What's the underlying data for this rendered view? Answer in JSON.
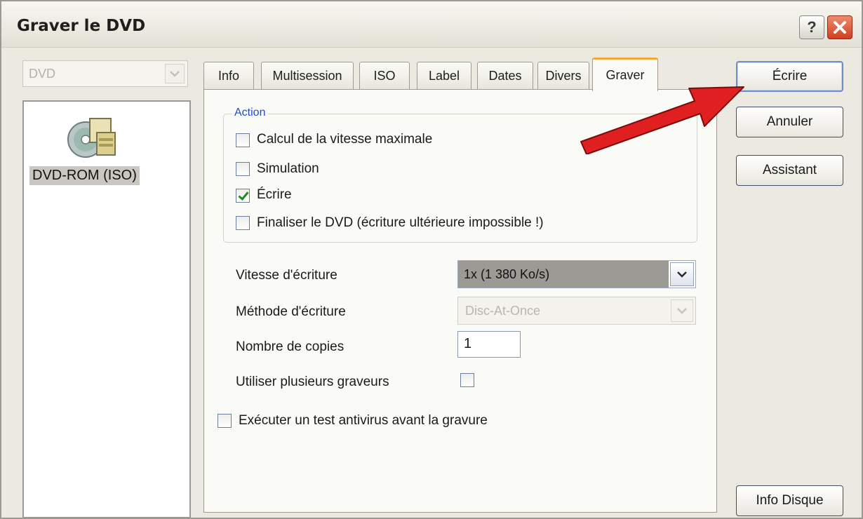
{
  "window": {
    "title": "Graver le DVD",
    "help_glyph": "?",
    "close_glyph": "✕"
  },
  "left": {
    "drive_combo": "DVD",
    "list_item": "DVD-ROM (ISO)"
  },
  "tabs": [
    {
      "label": "Info"
    },
    {
      "label": "Multisession"
    },
    {
      "label": "ISO"
    },
    {
      "label": "Label"
    },
    {
      "label": "Dates"
    },
    {
      "label": "Divers"
    },
    {
      "label": "Graver",
      "active": true
    }
  ],
  "action_group": {
    "title": "Action",
    "options": [
      {
        "label": "Calcul de la vitesse maximale",
        "checked": false
      },
      {
        "label": "Simulation",
        "checked": false
      },
      {
        "label": "Écrire",
        "checked": true
      },
      {
        "label": "Finaliser le DVD (écriture ultérieure impossible !)",
        "checked": false
      }
    ]
  },
  "settings": {
    "speed_label": "Vitesse d'écriture",
    "speed_value": "1x (1 380 Ko/s)",
    "method_label": "Méthode d'écriture",
    "method_value": "Disc-At-Once",
    "copies_label": "Nombre de copies",
    "copies_value": "1",
    "multi_label": "Utiliser plusieurs graveurs",
    "multi_checked": false,
    "antivirus_label": "Exécuter un test antivirus avant la gravure",
    "antivirus_checked": false
  },
  "buttons": {
    "write": "Écrire",
    "cancel": "Annuler",
    "wizard": "Assistant",
    "disc_info": "Info Disque"
  },
  "colors": {
    "accent_tab": "#f2a93b",
    "group_title": "#1f4fbf",
    "arrow": "#e02020"
  }
}
